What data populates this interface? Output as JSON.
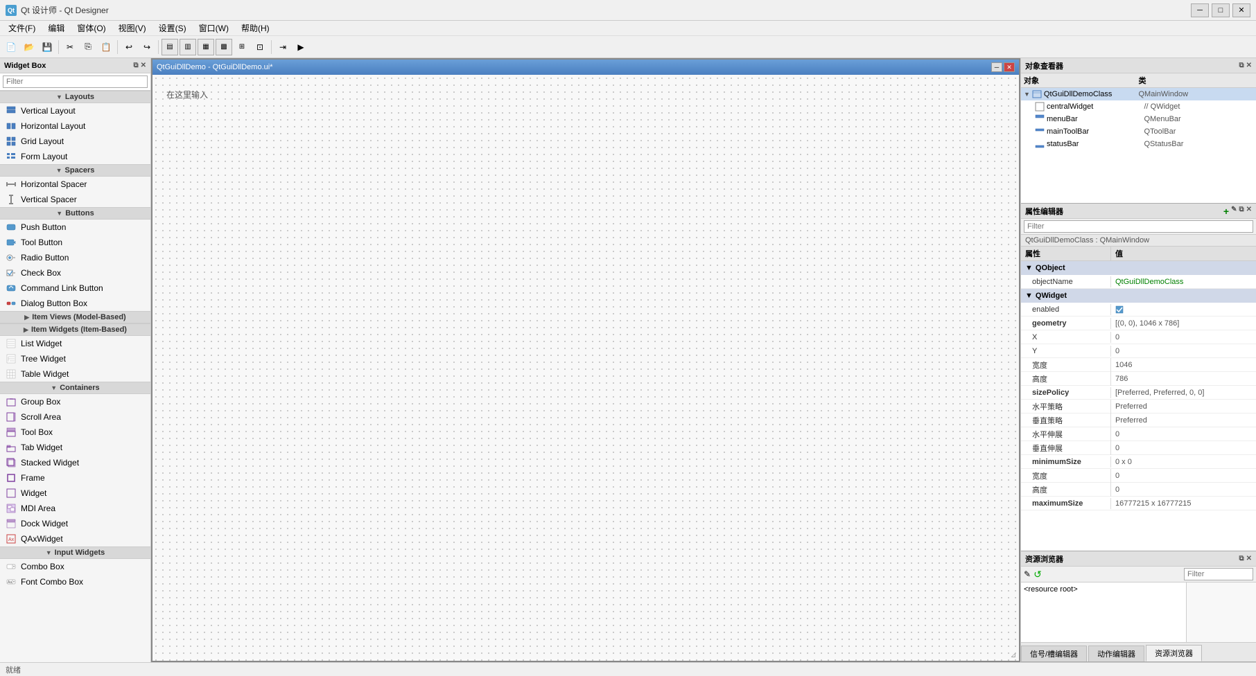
{
  "app": {
    "title": "Qt 设计师 - Qt Designer",
    "icon_text": "Qt"
  },
  "title_bar": {
    "minimize_label": "─",
    "restore_label": "□",
    "close_label": "✕"
  },
  "menu_bar": {
    "items": [
      {
        "label": "文件(F)"
      },
      {
        "label": "编辑"
      },
      {
        "label": "窗体(O)"
      },
      {
        "label": "视图(V)"
      },
      {
        "label": "设置(S)"
      },
      {
        "label": "窗口(W)"
      },
      {
        "label": "帮助(H)"
      }
    ]
  },
  "widget_box": {
    "title": "Widget Box",
    "filter_placeholder": "Filter",
    "sections": [
      {
        "name": "Layouts",
        "items": [
          {
            "label": "Vertical Layout",
            "icon": "vl"
          },
          {
            "label": "Horizontal Layout",
            "icon": "hl"
          },
          {
            "label": "Grid Layout",
            "icon": "gl"
          },
          {
            "label": "Form Layout",
            "icon": "fl"
          }
        ]
      },
      {
        "name": "Spacers",
        "items": [
          {
            "label": "Horizontal Spacer",
            "icon": "hs"
          },
          {
            "label": "Vertical Spacer",
            "icon": "vs"
          }
        ]
      },
      {
        "name": "Buttons",
        "items": [
          {
            "label": "Push Button",
            "icon": "pb"
          },
          {
            "label": "Tool Button",
            "icon": "tb"
          },
          {
            "label": "Radio Button",
            "icon": "rb"
          },
          {
            "label": "Check Box",
            "icon": "cb"
          },
          {
            "label": "Command Link Button",
            "icon": "clb"
          },
          {
            "label": "Dialog Button Box",
            "icon": "dbb"
          }
        ]
      },
      {
        "name": "Item Views (Model-Based)",
        "items": []
      },
      {
        "name": "Item Widgets (Item-Based)",
        "items": [
          {
            "label": "List Widget",
            "icon": "lw"
          },
          {
            "label": "Tree Widget",
            "icon": "tw"
          },
          {
            "label": "Table Widget",
            "icon": "taw"
          }
        ]
      },
      {
        "name": "Containers",
        "items": [
          {
            "label": "Group Box",
            "icon": "gb"
          },
          {
            "label": "Scroll Area",
            "icon": "sa"
          },
          {
            "label": "Tool Box",
            "icon": "tob"
          },
          {
            "label": "Tab Widget",
            "icon": "tabw"
          },
          {
            "label": "Stacked Widget",
            "icon": "sw"
          },
          {
            "label": "Frame",
            "icon": "fr"
          },
          {
            "label": "Widget",
            "icon": "wg"
          },
          {
            "label": "MDI Area",
            "icon": "mdi"
          },
          {
            "label": "Dock Widget",
            "icon": "dw"
          },
          {
            "label": "QAxWidget",
            "icon": "qax"
          }
        ]
      },
      {
        "name": "Input Widgets",
        "items": [
          {
            "label": "Combo Box",
            "icon": "comb"
          },
          {
            "label": "Font Combo Box",
            "icon": "fcb"
          }
        ]
      }
    ]
  },
  "inner_window": {
    "title": "QtGuiDllDemo - QtGuiDllDemo.ui*",
    "hint": "在这里输入",
    "minimize_label": "─",
    "close_label": "✕"
  },
  "object_inspector": {
    "title": "对象查看器",
    "col_object": "对象",
    "col_class": "类",
    "rows": [
      {
        "indent": 0,
        "name": "QtGuiDllDemoClass",
        "class": "QMainWindow",
        "has_child": true
      },
      {
        "indent": 1,
        "name": "centralWidget",
        "class": "QWidget",
        "has_child": false
      },
      {
        "indent": 1,
        "name": "menuBar",
        "class": "QMenuBar",
        "has_child": false
      },
      {
        "indent": 1,
        "name": "mainToolBar",
        "class": "QToolBar",
        "has_child": false
      },
      {
        "indent": 1,
        "name": "statusBar",
        "class": "QStatusBar",
        "has_child": false
      }
    ]
  },
  "properties_editor": {
    "title": "属性编辑器",
    "filter_placeholder": "Filter",
    "class_label": "QtGuiDllDemoClass : QMainWindow",
    "col_property": "属性",
    "col_value": "值",
    "sections": [
      {
        "name": "QObject",
        "properties": [
          {
            "name": "objectName",
            "value": "QtGuiDllDemoClass",
            "type": "green"
          }
        ]
      },
      {
        "name": "QWidget",
        "properties": [
          {
            "name": "enabled",
            "value": "☑",
            "type": "normal"
          },
          {
            "name": "geometry",
            "value": "[(0, 0), 1046 x 786]",
            "type": "normal"
          },
          {
            "name": "X",
            "value": "0",
            "type": "normal"
          },
          {
            "name": "Y",
            "value": "0",
            "type": "normal"
          },
          {
            "name": "宽度",
            "value": "1046",
            "type": "normal"
          },
          {
            "name": "高度",
            "value": "786",
            "type": "normal"
          },
          {
            "name": "sizePolicy",
            "value": "[Preferred, Preferred, 0, 0]",
            "type": "normal"
          },
          {
            "name": "水平策略",
            "value": "Preferred",
            "type": "normal"
          },
          {
            "name": "垂直策略",
            "value": "Preferred",
            "type": "normal"
          },
          {
            "name": "水平伸展",
            "value": "0",
            "type": "normal"
          },
          {
            "name": "垂直伸展",
            "value": "0",
            "type": "normal"
          },
          {
            "name": "minimumSize",
            "value": "0 x 0",
            "type": "normal"
          },
          {
            "name": "宽度",
            "value": "0",
            "type": "normal"
          },
          {
            "name": "高度",
            "value": "0",
            "type": "normal"
          },
          {
            "name": "maximumSize",
            "value": "16777215 x 16777215",
            "type": "normal"
          }
        ]
      }
    ]
  },
  "resource_browser": {
    "title": "资源浏览器",
    "filter_placeholder": "Filter",
    "root_item": "<resource root>",
    "pencil_icon": "✎",
    "refresh_icon": "↺"
  },
  "bottom_tabs": [
    {
      "label": "信号/槽编辑器",
      "active": false
    },
    {
      "label": "动作编辑器",
      "active": false
    },
    {
      "label": "资源浏览器",
      "active": true
    }
  ],
  "status_bar": {
    "text": "就绪"
  }
}
